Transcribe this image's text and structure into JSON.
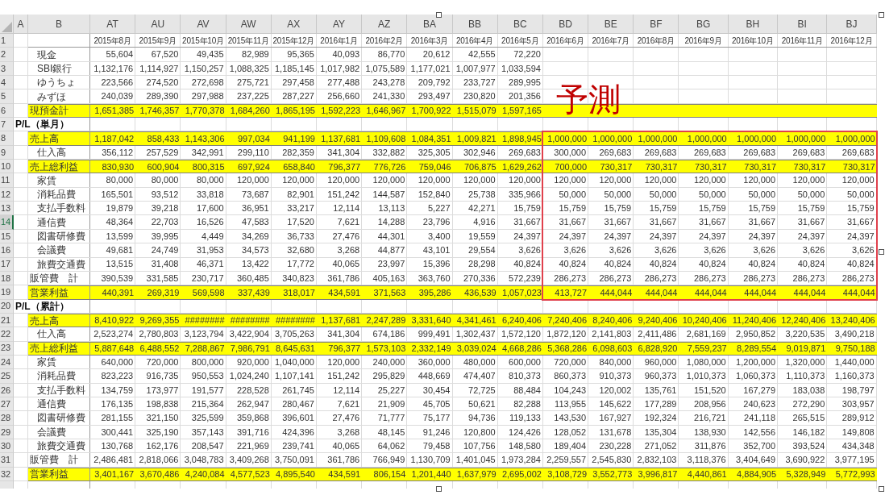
{
  "columns": [
    "A",
    "B",
    "AT",
    "AU",
    "AV",
    "AW",
    "AX",
    "AY",
    "AZ",
    "BA",
    "BB",
    "BC",
    "BD",
    "BE",
    "BF",
    "BG",
    "BH",
    "BI",
    "BJ"
  ],
  "rows": [
    {
      "number": "1",
      "selected": false,
      "kind": "header",
      "cells": [
        "2015年8月",
        "2015年9月",
        "2015年10月",
        "2015年11月",
        "2015年12月",
        "2016年1月",
        "2016年2月",
        "2016年3月",
        "2016年4月",
        "2016年5月",
        "2016年6月",
        "2016年7月",
        "2016年8月",
        "2016年9月",
        "2016年10月",
        "2016年11月",
        "2016年12月"
      ]
    },
    {
      "number": "2",
      "selected": false,
      "kind": "item",
      "label": "現金",
      "cells": [
        "55,604",
        "67,520",
        "49,435",
        "82,989",
        "95,365",
        "40,093",
        "86,770",
        "20,612",
        "42,555",
        "72,220"
      ]
    },
    {
      "number": "3",
      "selected": false,
      "kind": "item",
      "label": "SBI銀行",
      "cells": [
        "1,132,176",
        "1,114,927",
        "1,150,257",
        "1,088,325",
        "1,185,145",
        "1,017,982",
        "1,075,589",
        "1,177,021",
        "1,007,977",
        "1,033,594"
      ]
    },
    {
      "number": "4",
      "selected": false,
      "kind": "item",
      "label": "ゆうちょ",
      "cells": [
        "223,566",
        "274,520",
        "272,698",
        "275,721",
        "297,458",
        "277,488",
        "243,278",
        "209,792",
        "233,727",
        "289,995"
      ]
    },
    {
      "number": "5",
      "selected": false,
      "kind": "item",
      "label": "みずほ",
      "cells": [
        "240,039",
        "289,390",
        "297,988",
        "237,225",
        "287,227",
        "256,660",
        "241,330",
        "293,497",
        "230,820",
        "201,356"
      ]
    },
    {
      "number": "6",
      "selected": false,
      "kind": "total",
      "label": "現預金計",
      "cells": [
        "1,651,385",
        "1,746,357",
        "1,770,378",
        "1,684,260",
        "1,865,195",
        "1,592,223",
        "1,646,967",
        "1,700,922",
        "1,515,079",
        "1,597,165"
      ]
    },
    {
      "number": "7",
      "selected": false,
      "kind": "section",
      "label": "P/L（単月）"
    },
    {
      "number": "8",
      "selected": false,
      "kind": "total",
      "label": "売上高",
      "cells": [
        "1,187,042",
        "858,433",
        "1,143,306",
        "997,034",
        "941,199",
        "1,137,681",
        "1,109,608",
        "1,084,351",
        "1,009,821",
        "1,898,945",
        "1,000,000",
        "1,000,000",
        "1,000,000",
        "1,000,000",
        "1,000,000",
        "1,000,000",
        "1,000,000"
      ]
    },
    {
      "number": "9",
      "selected": false,
      "kind": "item",
      "label": "仕入高",
      "cells": [
        "356,112",
        "257,529",
        "342,991",
        "299,110",
        "282,359",
        "341,304",
        "332,882",
        "325,305",
        "302,946",
        "269,683",
        "300,000",
        "269,683",
        "269,683",
        "269,683",
        "269,683",
        "269,683",
        "269,683"
      ]
    },
    {
      "number": "10",
      "selected": false,
      "kind": "total",
      "label": "売上総利益",
      "cells": [
        "830,930",
        "600,904",
        "800,315",
        "697,924",
        "658,840",
        "796,377",
        "776,726",
        "759,046",
        "706,875",
        "1,629,262",
        "700,000",
        "730,317",
        "730,317",
        "730,317",
        "730,317",
        "730,317",
        "730,317"
      ]
    },
    {
      "number": "11",
      "selected": false,
      "kind": "item",
      "label": "家賃",
      "cells": [
        "80,000",
        "80,000",
        "80,000",
        "120,000",
        "120,000",
        "120,000",
        "120,000",
        "120,000",
        "120,000",
        "120,000",
        "120,000",
        "120,000",
        "120,000",
        "120,000",
        "120,000",
        "120,000",
        "120,000"
      ]
    },
    {
      "number": "12",
      "selected": false,
      "kind": "item",
      "label": "消耗品費",
      "cells": [
        "165,501",
        "93,512",
        "33,818",
        "73,687",
        "82,901",
        "151,242",
        "144,587",
        "152,840",
        "25,738",
        "335,966",
        "50,000",
        "50,000",
        "50,000",
        "50,000",
        "50,000",
        "50,000",
        "50,000"
      ]
    },
    {
      "number": "13",
      "selected": false,
      "kind": "item",
      "label": "支払手数料",
      "cells": [
        "19,879",
        "39,218",
        "17,600",
        "36,951",
        "33,217",
        "12,114",
        "13,113",
        "5,227",
        "42,271",
        "15,759",
        "15,759",
        "15,759",
        "15,759",
        "15,759",
        "15,759",
        "15,759",
        "15,759"
      ]
    },
    {
      "number": "14",
      "selected": true,
      "kind": "item",
      "label": "通信費",
      "cells": [
        "48,364",
        "22,703",
        "16,526",
        "47,583",
        "17,520",
        "7,621",
        "14,288",
        "23,796",
        "4,916",
        "31,667",
        "31,667",
        "31,667",
        "31,667",
        "31,667",
        "31,667",
        "31,667",
        "31,667"
      ]
    },
    {
      "number": "15",
      "selected": false,
      "kind": "item",
      "label": "図書研修費",
      "cells": [
        "13,599",
        "39,995",
        "4,449",
        "34,269",
        "36,733",
        "27,476",
        "44,301",
        "3,400",
        "19,559",
        "24,397",
        "24,397",
        "24,397",
        "24,397",
        "24,397",
        "24,397",
        "24,397",
        "24,397"
      ]
    },
    {
      "number": "16",
      "selected": false,
      "kind": "item",
      "label": "会議費",
      "cells": [
        "49,681",
        "24,749",
        "31,953",
        "34,573",
        "32,680",
        "3,268",
        "44,877",
        "43,101",
        "29,554",
        "3,626",
        "3,626",
        "3,626",
        "3,626",
        "3,626",
        "3,626",
        "3,626",
        "3,626"
      ]
    },
    {
      "number": "17",
      "selected": false,
      "kind": "item",
      "label": "旅費交通費",
      "cells": [
        "13,515",
        "31,408",
        "46,371",
        "13,422",
        "17,772",
        "40,065",
        "23,997",
        "15,396",
        "28,298",
        "40,824",
        "40,824",
        "40,824",
        "40,824",
        "40,824",
        "40,824",
        "40,824",
        "40,824"
      ]
    },
    {
      "number": "18",
      "selected": false,
      "kind": "subtotal",
      "label": "販管費　計",
      "cells": [
        "390,539",
        "331,585",
        "230,717",
        "360,485",
        "340,823",
        "361,786",
        "405,163",
        "363,760",
        "270,336",
        "572,239",
        "286,273",
        "286,273",
        "286,273",
        "286,273",
        "286,273",
        "286,273",
        "286,273"
      ]
    },
    {
      "number": "19",
      "selected": false,
      "kind": "total",
      "label": "営業利益",
      "cells": [
        "440,391",
        "269,319",
        "569,598",
        "337,439",
        "318,017",
        "434,591",
        "371,563",
        "395,286",
        "436,539",
        "1,057,023",
        "413,727",
        "444,044",
        "444,044",
        "444,044",
        "444,044",
        "444,044",
        "444,044"
      ]
    },
    {
      "number": "20",
      "selected": false,
      "kind": "section",
      "label": "P/L（累計）"
    },
    {
      "number": "21",
      "selected": false,
      "kind": "total",
      "label": "売上高",
      "cells": [
        "8,410,922",
        "9,269,355",
        "########",
        "########",
        "########",
        "1,137,681",
        "2,247,289",
        "3,331,640",
        "4,341,461",
        "6,240,406",
        "7,240,406",
        "8,240,406",
        "9,240,406",
        "10,240,406",
        "11,240,406",
        "12,240,406",
        "13,240,406"
      ]
    },
    {
      "number": "22",
      "selected": false,
      "kind": "item",
      "label": "仕入高",
      "cells": [
        "2,523,274",
        "2,780,803",
        "3,123,794",
        "3,422,904",
        "3,705,263",
        "341,304",
        "674,186",
        "999,491",
        "1,302,437",
        "1,572,120",
        "1,872,120",
        "2,141,803",
        "2,411,486",
        "2,681,169",
        "2,950,852",
        "3,220,535",
        "3,490,218"
      ]
    },
    {
      "number": "23",
      "selected": false,
      "kind": "total",
      "label": "売上総利益",
      "cells": [
        "5,887,648",
        "6,488,552",
        "7,288,867",
        "7,986,791",
        "8,645,631",
        "796,377",
        "1,573,103",
        "2,332,149",
        "3,039,024",
        "4,668,286",
        "5,368,286",
        "6,098,603",
        "6,828,920",
        "7,559,237",
        "8,289,554",
        "9,019,871",
        "9,750,188"
      ]
    },
    {
      "number": "24",
      "selected": false,
      "kind": "item",
      "label": "家賃",
      "cells": [
        "640,000",
        "720,000",
        "800,000",
        "920,000",
        "1,040,000",
        "120,000",
        "240,000",
        "360,000",
        "480,000",
        "600,000",
        "720,000",
        "840,000",
        "960,000",
        "1,080,000",
        "1,200,000",
        "1,320,000",
        "1,440,000"
      ]
    },
    {
      "number": "25",
      "selected": false,
      "kind": "item",
      "label": "消耗品費",
      "cells": [
        "823,223",
        "916,735",
        "950,553",
        "1,024,240",
        "1,107,141",
        "151,242",
        "295,829",
        "448,669",
        "474,407",
        "810,373",
        "860,373",
        "910,373",
        "960,373",
        "1,010,373",
        "1,060,373",
        "1,110,373",
        "1,160,373"
      ]
    },
    {
      "number": "26",
      "selected": false,
      "kind": "item",
      "label": "支払手数料",
      "cells": [
        "134,759",
        "173,977",
        "191,577",
        "228,528",
        "261,745",
        "12,114",
        "25,227",
        "30,454",
        "72,725",
        "88,484",
        "104,243",
        "120,002",
        "135,761",
        "151,520",
        "167,279",
        "183,038",
        "198,797"
      ]
    },
    {
      "number": "27",
      "selected": false,
      "kind": "item",
      "label": "通信費",
      "cells": [
        "176,135",
        "198,838",
        "215,364",
        "262,947",
        "280,467",
        "7,621",
        "21,909",
        "45,705",
        "50,621",
        "82,288",
        "113,955",
        "145,622",
        "177,289",
        "208,956",
        "240,623",
        "272,290",
        "303,957"
      ]
    },
    {
      "number": "28",
      "selected": false,
      "kind": "item",
      "label": "図書研修費",
      "cells": [
        "281,155",
        "321,150",
        "325,599",
        "359,868",
        "396,601",
        "27,476",
        "71,777",
        "75,177",
        "94,736",
        "119,133",
        "143,530",
        "167,927",
        "192,324",
        "216,721",
        "241,118",
        "265,515",
        "289,912"
      ]
    },
    {
      "number": "29",
      "selected": false,
      "kind": "item",
      "label": "会議費",
      "cells": [
        "300,441",
        "325,190",
        "357,143",
        "391,716",
        "424,396",
        "3,268",
        "48,145",
        "91,246",
        "120,800",
        "124,426",
        "128,052",
        "131,678",
        "135,304",
        "138,930",
        "142,556",
        "146,182",
        "149,808"
      ]
    },
    {
      "number": "30",
      "selected": false,
      "kind": "item",
      "label": "旅費交通費",
      "cells": [
        "130,768",
        "162,176",
        "208,547",
        "221,969",
        "239,741",
        "40,065",
        "64,062",
        "79,458",
        "107,756",
        "148,580",
        "189,404",
        "230,228",
        "271,052",
        "311,876",
        "352,700",
        "393,524",
        "434,348"
      ]
    },
    {
      "number": "31",
      "selected": false,
      "kind": "subtotal",
      "label": "販管費　計",
      "cells": [
        "2,486,481",
        "2,818,066",
        "3,048,783",
        "3,409,268",
        "3,750,091",
        "361,786",
        "766,949",
        "1,130,709",
        "1,401,045",
        "1,973,284",
        "2,259,557",
        "2,545,830",
        "2,832,103",
        "3,118,376",
        "3,404,649",
        "3,690,922",
        "3,977,195"
      ]
    },
    {
      "number": "32",
      "selected": false,
      "kind": "total",
      "label": "営業利益",
      "cells": [
        "3,401,167",
        "3,670,486",
        "4,240,084",
        "4,577,523",
        "4,895,540",
        "434,591",
        "806,154",
        "1,201,440",
        "1,637,979",
        "2,695,002",
        "3,108,729",
        "3,552,773",
        "3,996,817",
        "4,440,861",
        "4,884,905",
        "5,328,949",
        "5,772,993"
      ]
    }
  ],
  "annotation": {
    "text": "予測"
  }
}
